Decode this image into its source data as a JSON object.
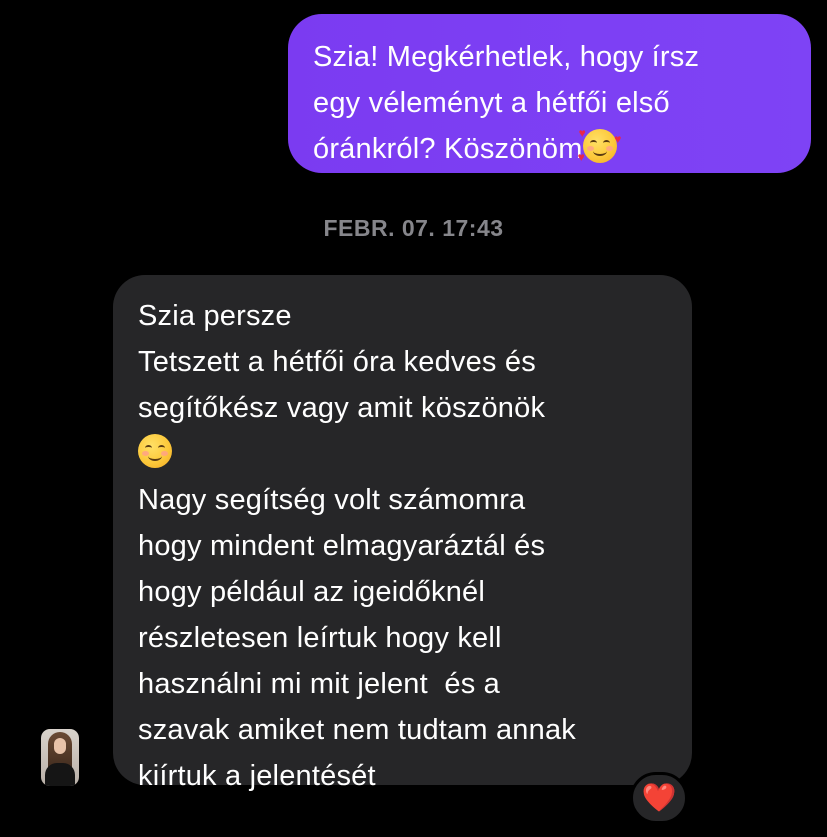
{
  "conversation": {
    "outgoing": {
      "text": "Szia! Megkérhetlek, hogy írsz\negy véleményt a hétfői első\nóránkról? Köszönöm",
      "emoji": "smiling-face-with-hearts"
    },
    "timestamp": "FEBR. 07. 17:43",
    "incoming": {
      "line1": "Szia persze",
      "line2": "Tetszett a hétfői óra kedves és\nsegítőkész vagy amit köszönök",
      "emoji": "smiling-face-with-smiling-eyes",
      "line3": "Nagy segítség volt számomra\nhogy mindent elmagyaráztál és\nhogy például az igeidőknél\nrészletesen leírtuk hogy kell\nhasználni mi mit jelent  és a\nszavak amiket nem tudtam annak\nkiírtuk a jelentését"
    },
    "reaction": {
      "symbol": "❤️",
      "icon": "red-heart"
    },
    "avatar": {
      "icon": "profile-photo"
    }
  },
  "colors": {
    "background": "#000000",
    "outgoing_bubble": "#7b3bf1",
    "incoming_bubble": "#262628",
    "timestamp_text": "#86868b",
    "heart": "#e0243a"
  }
}
